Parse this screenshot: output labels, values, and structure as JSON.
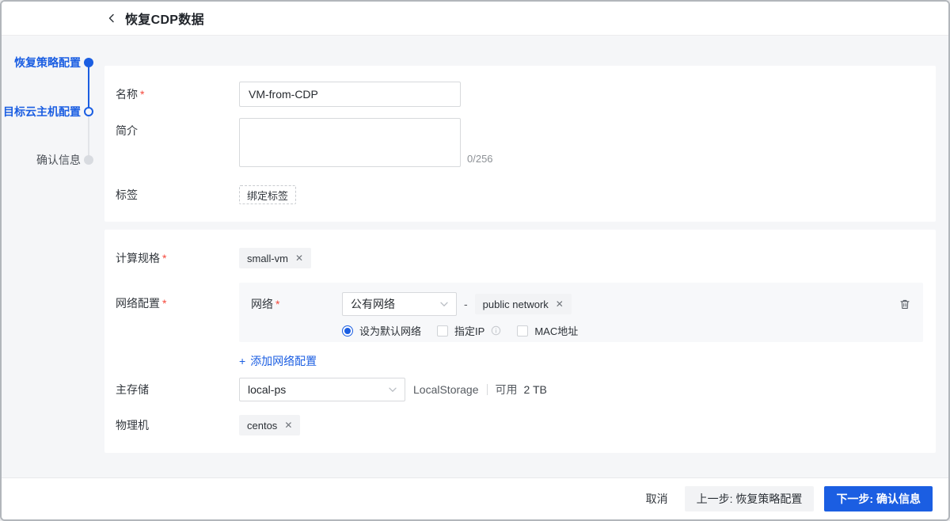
{
  "header": {
    "title": "恢复CDP数据"
  },
  "steps": [
    {
      "label": "恢复策略配置"
    },
    {
      "label": "目标云主机配置"
    },
    {
      "label": "确认信息"
    }
  ],
  "marks": {
    "required": "*",
    "close": "✕",
    "plus": "+",
    "dash": "-"
  },
  "basic": {
    "name_label": "名称",
    "name_value": "VM-from-CDP",
    "desc_label": "简介",
    "desc_counter": "0/256",
    "tag_label": "标签",
    "bind_tag_button": "绑定标签"
  },
  "config": {
    "spec_label": "计算规格",
    "spec_tag": "small-vm",
    "network_section_label": "网络配置",
    "network": {
      "row_label": "网络",
      "l3_select_value": "公有网络",
      "network_tag": "public network",
      "default_radio_label": "设为默认网络",
      "ip_checkbox_label": "指定IP",
      "mac_checkbox_label": "MAC地址"
    },
    "add_network_link": "添加网络配置",
    "storage_label": "主存储",
    "storage_select_value": "local-ps",
    "storage_type": "LocalStorage",
    "storage_avail_label": "可用",
    "storage_avail_value": "2 TB",
    "host_label": "物理机",
    "host_tag": "centos"
  },
  "footer": {
    "cancel": "取消",
    "prev": "上一步: 恢复策略配置",
    "next": "下一步: 确认信息"
  },
  "colors": {
    "primary": "#1b5ee2",
    "required": "#f5483b"
  }
}
